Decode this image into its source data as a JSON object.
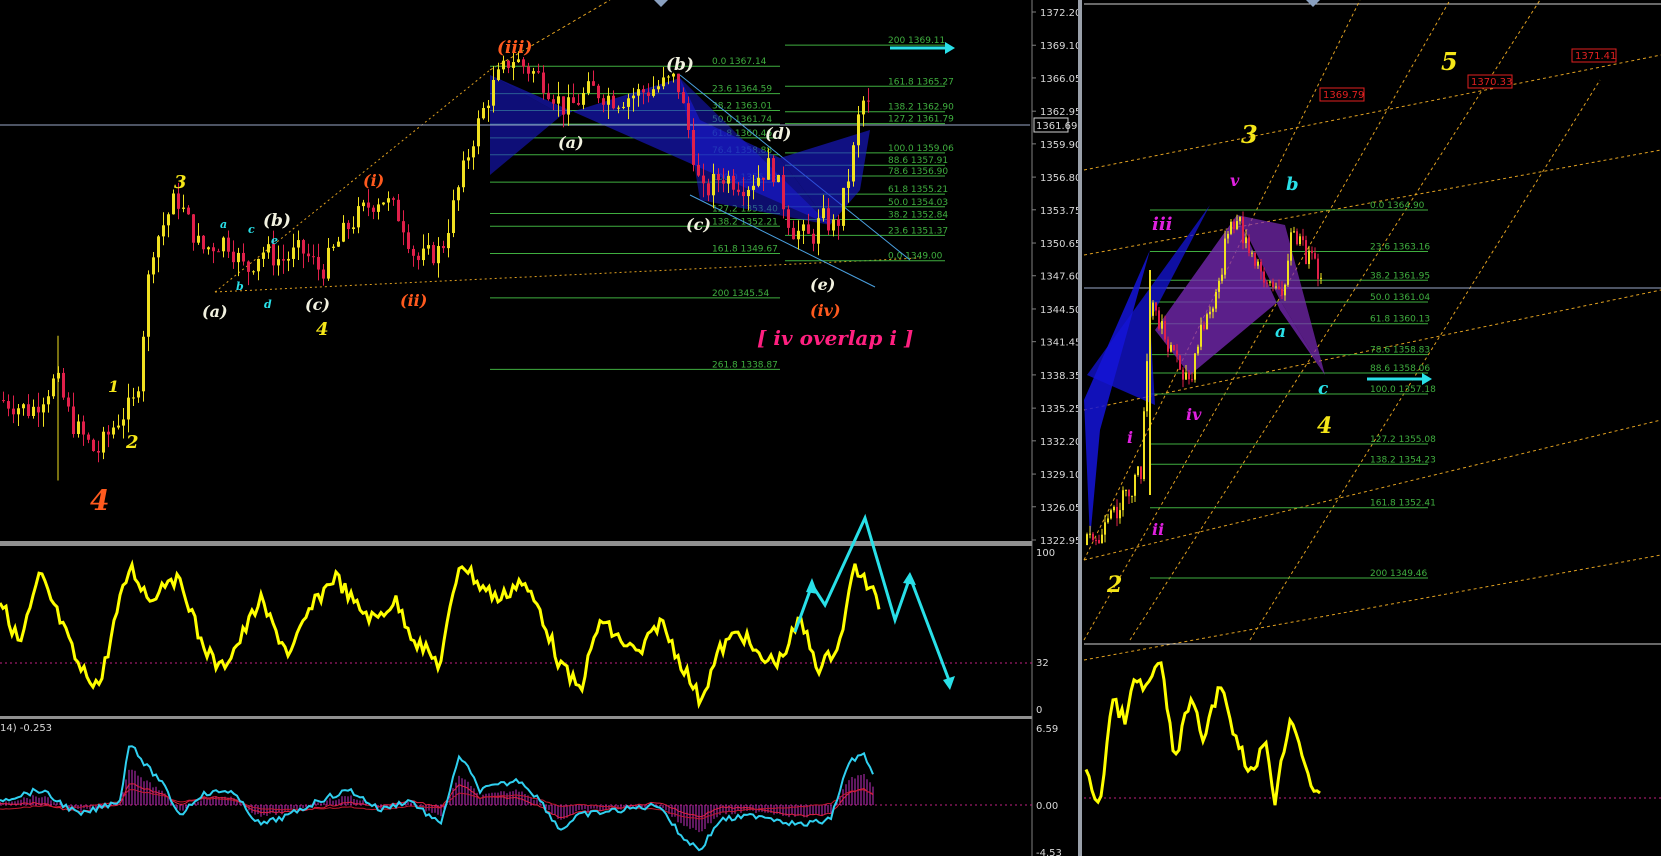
{
  "left_panel": {
    "price_axis": [
      "1372.20",
      "1369.10",
      "1366.05",
      "1362.95",
      "1359.90",
      "1356.80",
      "1353.75",
      "1350.65",
      "1347.60",
      "1344.50",
      "1341.45",
      "1338.35",
      "1335.25",
      "1332.20",
      "1329.10",
      "1326.05",
      "1322.95"
    ],
    "current_price": "1361.69",
    "osc_axis": [
      "100",
      "32",
      "0"
    ],
    "macd_axis": [
      "6.59",
      "0.00",
      "-4.53"
    ],
    "macd_label": "14) -0.253",
    "overlap_note": "[ iv overlap i ]"
  },
  "right_panel": {
    "price_tags": [
      "1369.79",
      "1370.33",
      "1371.41"
    ]
  },
  "colors": {
    "background": "#000000",
    "bull_candle": "#f0e020",
    "bear_candle": "#e0204a",
    "fib_green": "#3fae3f",
    "wave_yellow": "#f5e618",
    "wave_white": "#f2f2e0",
    "wave_orange": "#ff5a1e",
    "wave_magenta": "#e020e0",
    "wave_cyan": "#29e0e8",
    "pattern_blue": "#1010d0",
    "pattern_purple": "#7a2ab8",
    "osc_line": "#ffff00",
    "macd_cyan": "#30d0f0",
    "trend_orange": "#e0a020"
  },
  "chart_data": [
    {
      "type": "line",
      "title": "",
      "subtitle": "Elliott wave count, candlestick price panel",
      "ylim": [
        1322.95,
        1372.2
      ],
      "y_ticks": [
        1372.2,
        1369.1,
        1366.05,
        1362.95,
        1359.9,
        1356.8,
        1353.75,
        1350.65,
        1347.6,
        1344.5,
        1341.45,
        1338.35,
        1335.25,
        1332.2,
        1329.1,
        1326.05,
        1322.95
      ],
      "current_price": 1361.69,
      "wave_labels": [
        {
          "text": "4",
          "color": "orange",
          "price": 1327.5
        },
        {
          "text": "1",
          "color": "yellow",
          "price": 1335.5
        },
        {
          "text": "2",
          "color": "yellow",
          "price": 1331.0
        },
        {
          "text": "3",
          "color": "yellow",
          "price": 1355.5
        },
        {
          "text": "(a)",
          "color": "white",
          "price": 1346.5
        },
        {
          "text": "(b)",
          "color": "white",
          "price": 1352.5
        },
        {
          "text": "(c)",
          "color": "white",
          "price": 1347.0
        },
        {
          "text": "4",
          "color": "yellow",
          "price": 1344.5
        },
        {
          "text": "(i)",
          "color": "orange",
          "price": 1355.8
        },
        {
          "text": "(ii)",
          "color": "orange",
          "price": 1347.0
        },
        {
          "text": "(iii)",
          "color": "orange",
          "price": 1368.0
        },
        {
          "text": "(a)",
          "color": "white",
          "price": 1360.0
        },
        {
          "text": "(b)",
          "color": "white",
          "price": 1366.0
        },
        {
          "text": "(c)",
          "color": "white",
          "price": 1352.5
        },
        {
          "text": "(d)",
          "color": "white",
          "price": 1360.5
        },
        {
          "text": "(e)",
          "color": "white",
          "price": 1347.5
        },
        {
          "text": "(iv)",
          "color": "orange",
          "price": 1345.5
        },
        {
          "text": "a",
          "color": "cyan"
        },
        {
          "text": "b",
          "color": "cyan"
        },
        {
          "text": "c",
          "color": "cyan"
        },
        {
          "text": "d",
          "color": "cyan"
        },
        {
          "text": "e",
          "color": "cyan"
        }
      ],
      "fib_levels": [
        {
          "label": "0.0 1367.14",
          "value": 1367.14
        },
        {
          "label": "23.6 1364.59",
          "value": 1364.59
        },
        {
          "label": "38.2 1363.01",
          "value": 1363.01
        },
        {
          "label": "50.0 1361.74",
          "value": 1361.74
        },
        {
          "label": "61.8 1360.46",
          "value": 1360.46
        },
        {
          "label": "76.4 1358.88",
          "value": 1358.88
        },
        {
          "label": "100.0 1356.33",
          "value": 1356.33
        },
        {
          "label": "127.2 1353.40",
          "value": 1353.4
        },
        {
          "label": "138.2 1352.21",
          "value": 1352.21
        },
        {
          "label": "161.8 1349.67",
          "value": 1349.67
        },
        {
          "label": "200 1345.54",
          "value": 1345.54
        },
        {
          "label": "261.8 1338.87",
          "value": 1338.87
        }
      ],
      "fib_levels_right": [
        {
          "label": "200 1369.11",
          "value": 1369.11
        },
        {
          "label": "161.8 1365.27",
          "value": 1365.27
        },
        {
          "label": "138.2 1362.90",
          "value": 1362.9
        },
        {
          "label": "127.2 1361.79",
          "value": 1361.79
        },
        {
          "label": "100.0 1359.06",
          "value": 1359.06
        },
        {
          "label": "88.6 1357.91",
          "value": 1357.91
        },
        {
          "label": "78.6 1356.90",
          "value": 1356.9
        },
        {
          "label": "61.8 1355.21",
          "value": 1355.21
        },
        {
          "label": "50.0 1354.03",
          "value": 1354.03
        },
        {
          "label": "38.2 1352.84",
          "value": 1352.84
        },
        {
          "label": "23.6 1351.37",
          "value": 1351.37
        },
        {
          "label": "0.0 1349.00",
          "value": 1349.0
        }
      ]
    },
    {
      "type": "line",
      "title": "",
      "subtitle": "Oscillator panel (yellow line)",
      "ylim": [
        0,
        100
      ],
      "y_ticks": [
        100,
        32,
        0
      ],
      "reference_level": 32
    },
    {
      "type": "bar",
      "title": "",
      "subtitle": "MACD-style histogram panel",
      "ylim": [
        -4.53,
        6.59
      ],
      "y_ticks": [
        6.59,
        0.0,
        -4.53
      ],
      "label": "14) -0.253"
    },
    {
      "type": "line",
      "title": "",
      "subtitle": "Right price panel with channel lines",
      "price_tags": [
        1369.79,
        1370.33,
        1371.41
      ],
      "wave_labels": [
        {
          "text": "2",
          "color": "yellow"
        },
        {
          "text": "3",
          "color": "yellow"
        },
        {
          "text": "4",
          "color": "yellow"
        },
        {
          "text": "5",
          "color": "yellow"
        },
        {
          "text": "i",
          "color": "magenta"
        },
        {
          "text": "ii",
          "color": "magenta"
        },
        {
          "text": "iii",
          "color": "magenta"
        },
        {
          "text": "iv",
          "color": "magenta"
        },
        {
          "text": "v",
          "color": "magenta"
        },
        {
          "text": "a",
          "color": "cyan"
        },
        {
          "text": "b",
          "color": "cyan"
        },
        {
          "text": "c",
          "color": "cyan"
        }
      ],
      "fib_levels": [
        {
          "label": "0.0 1364.90",
          "value": 1364.9
        },
        {
          "label": "23.6 1363.16",
          "value": 1363.16
        },
        {
          "label": "38.2 1361.95",
          "value": 1361.95
        },
        {
          "label": "50.0 1361.04",
          "value": 1361.04
        },
        {
          "label": "61.8 1360.13",
          "value": 1360.13
        },
        {
          "label": "78.6 1358.83",
          "value": 1358.83
        },
        {
          "label": "88.6 1358.06",
          "value": 1358.06
        },
        {
          "label": "100.0 1357.18",
          "value": 1357.18
        },
        {
          "label": "127.2 1355.08",
          "value": 1355.08
        },
        {
          "label": "138.2 1354.23",
          "value": 1354.23
        },
        {
          "label": "161.8 1352.41",
          "value": 1352.41
        },
        {
          "label": "200 1349.46",
          "value": 1349.46
        }
      ]
    }
  ]
}
